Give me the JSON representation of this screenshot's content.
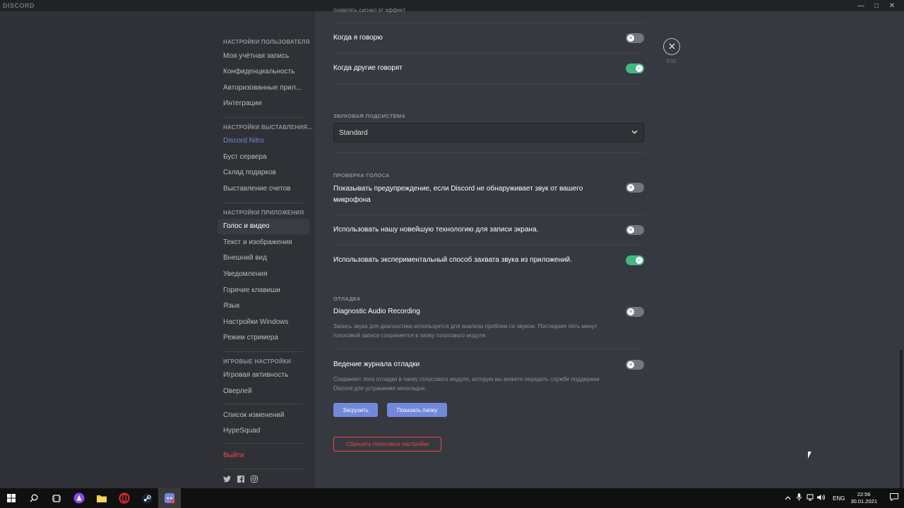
{
  "titlebar": {
    "app_name": "DISCORD",
    "minimize": "—",
    "maximize": "□",
    "close": "✕"
  },
  "sidebar": {
    "user_settings_header": "Настройки пользователя",
    "user_items": [
      "Моя учётная запись",
      "Конфиденциальность",
      "Авторизованные прил...",
      "Интеграции"
    ],
    "billing_header": "Настройки выставления...",
    "billing_items": [
      "Discord Nitro",
      "Буст сервера",
      "Склад подарков",
      "Выставление счетов"
    ],
    "app_header": "Настройки приложения",
    "app_items": [
      "Голос и видео",
      "Текст и изображения",
      "Внешний вид",
      "Уведомления",
      "Горячие клавиши",
      "Язык",
      "Настройки Windows",
      "Режим стримера"
    ],
    "game_header": "Игровые настройки",
    "game_items": [
      "Игровая активность",
      "Оверлей"
    ],
    "misc_items": [
      "Список изменений",
      "HypeSquad"
    ],
    "logout": "Выйти",
    "social_icons": [
      "twitter-icon",
      "facebook-icon",
      "instagram-icon"
    ]
  },
  "content": {
    "top_cut_text": "появлять сигнал эт эффект",
    "when_i_speak": "Когда я говорю",
    "when_others_speak": "Когда другие говорят",
    "audio_subsystem_header": "Звуковая подсистема",
    "audio_subsystem_value": "Standard",
    "voice_check_header": "Проверка голоса",
    "voice_warning_line1": "Показывать предупреждение, если Discord не обнаруживает звук от вашего",
    "voice_warning_line2": "микрофона",
    "screen_capture_tech": "Использовать нашу новейшую технологию для записи экрана.",
    "experimental_audio": "Использовать экспериментальный способ захвата звука из приложений.",
    "debug_header": "Отладка",
    "diagnostic_title": "Diagnostic Audio Recording",
    "diagnostic_desc_line1": "Запись звука для диагностики используется для анализа проблем со звуком. Последние пять минут",
    "diagnostic_desc_line2": "голосовой записи сохраняется в папку голосового модуля.",
    "debug_log_title": "Ведение журнала отладки",
    "debug_log_desc_line1": "Сохраняет логи отладки в папку голосового модуля, которую вы можете передать службе поддержки",
    "debug_log_desc_line2": "Discord для устранения неполадок.",
    "upload_button": "Загрузить",
    "show_folder_button": "Показать папку",
    "reset_button": "Сбросить голосовые настройки",
    "esc_label": "ESC"
  },
  "toggles": {
    "when_i_speak": false,
    "when_others_speak": true,
    "voice_warning": false,
    "screen_capture_tech": false,
    "experimental_audio": true,
    "diagnostic_recording": false,
    "debug_logging": false
  },
  "taskbar": {
    "language": "ENG",
    "time": "22:56",
    "date": "30.01.2021"
  },
  "colors": {
    "accent": "#7289da",
    "toggle_on": "#43b581",
    "danger": "#f04747"
  }
}
